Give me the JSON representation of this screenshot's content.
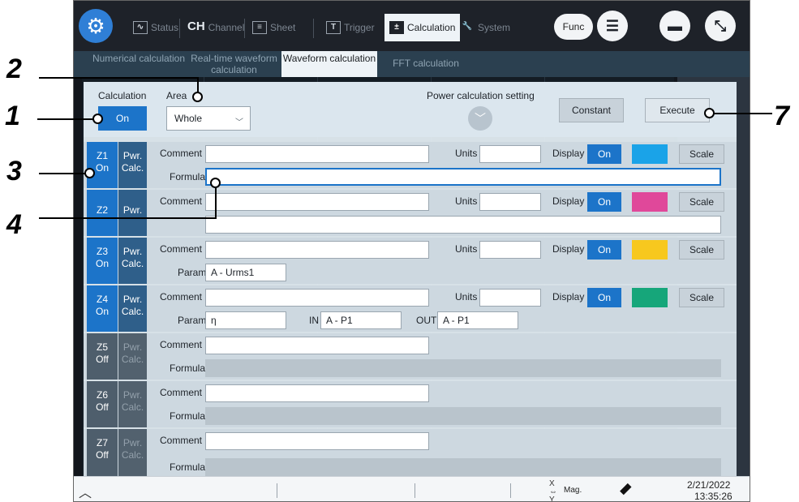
{
  "toolbar": {
    "tabs": [
      {
        "label": "Status",
        "icon": "waveform-icon"
      },
      {
        "label": "Channel",
        "icon": "channel-icon",
        "glyph": "CH"
      },
      {
        "label": "Sheet",
        "icon": "sheet-icon"
      },
      {
        "label": "Trigger",
        "icon": "trigger-icon"
      },
      {
        "label": "Calculation",
        "icon": "calculation-icon"
      },
      {
        "label": "System",
        "icon": "wrench-icon"
      }
    ],
    "func_label": "Func"
  },
  "subtabs": [
    {
      "label": "Numerical calculation"
    },
    {
      "label": "Real-time waveform calculation"
    },
    {
      "label": "Waveform calculation"
    },
    {
      "label": "FFT calculation"
    }
  ],
  "header": {
    "calculation_label": "Calculation",
    "calculation_value": "On",
    "area_label": "Area",
    "area_value": "Whole",
    "power_setting_label": "Power calculation setting",
    "constant_label": "Constant",
    "execute_label": "Execute"
  },
  "labels": {
    "comment": "Comment",
    "units": "Units",
    "display": "Display",
    "formula": "Formula",
    "param": "Param",
    "in": "IN",
    "out": "OUT",
    "scale": "Scale",
    "pwr": "Pwr.",
    "calc": "Calc."
  },
  "rows": [
    {
      "z": "Z1",
      "state": "On",
      "display": "On",
      "color": "#1aa3e8",
      "param": ""
    },
    {
      "z": "Z2",
      "state": "",
      "display": "On",
      "color": "#e0489a",
      "param": ""
    },
    {
      "z": "Z3",
      "state": "On",
      "display": "On",
      "color": "#f7c81e",
      "param": "A - Urms1"
    },
    {
      "z": "Z4",
      "state": "On",
      "display": "On",
      "color": "#16a67a",
      "param": "η",
      "in": "A - P1",
      "out": "A - P1"
    },
    {
      "z": "Z5",
      "state": "Off"
    },
    {
      "z": "Z6",
      "state": "Off"
    },
    {
      "z": "Z7",
      "state": "Off"
    }
  ],
  "status": {
    "mag_label": "Mag.",
    "date": "2/21/2022",
    "time": "13:35:26"
  },
  "callouts": [
    "1",
    "2",
    "3",
    "4",
    "7"
  ]
}
